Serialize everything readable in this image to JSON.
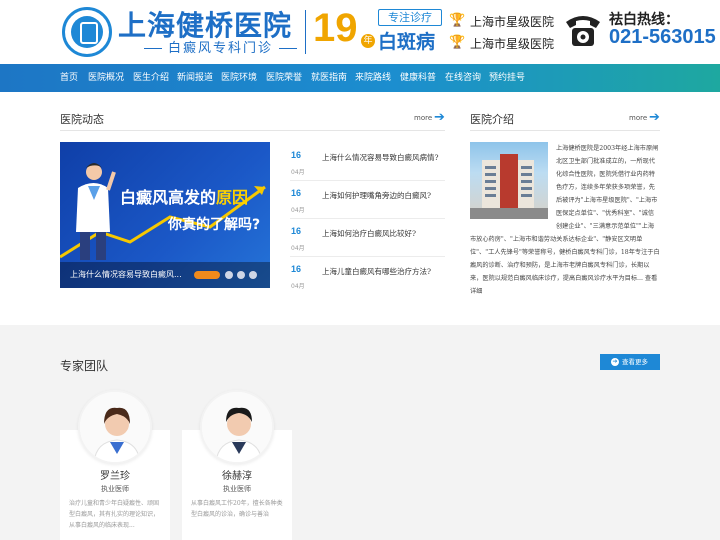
{
  "header": {
    "brand_name": "上海健桥医院",
    "brand_sub": "白癜风专科门诊",
    "years": "19",
    "year_unit": "年",
    "focus_tag": "专注诊疗",
    "focus_big": "白斑病",
    "star_items": [
      "上海市星级医院",
      "上海市星级医院"
    ],
    "hotline_label": "祛白热线：",
    "hotline_number": "021-563015",
    "colors": {
      "primary": "#1e6fc6",
      "accent": "#f0a500"
    }
  },
  "nav": {
    "items": [
      "首页",
      "医院概况",
      "医生介绍",
      "新闻报道",
      "医院环境",
      "医院荣誉",
      "就医指南",
      "来院路线",
      "健康科普",
      "在线咨询",
      "预约挂号"
    ]
  },
  "news": {
    "title": "医院动态",
    "more": "more",
    "banner_line1_a": "白癜风高发的",
    "banner_line1_b": "原因",
    "banner_line2": "你真的了解吗?",
    "caption": "上海什么情况容易导致白癜风...",
    "items": [
      {
        "day": "16",
        "month": "04月",
        "title": "上海什么情况容易导致白癜风病情?"
      },
      {
        "day": "16",
        "month": "04月",
        "title": "上海如何护理嘴角旁边的白癜风?"
      },
      {
        "day": "16",
        "month": "04月",
        "title": "上海如何治疗白癜风比较好?"
      },
      {
        "day": "16",
        "month": "04月",
        "title": "上海儿童白癜风有哪些治疗方法?"
      }
    ]
  },
  "intro": {
    "title": "医院介绍",
    "more": "more",
    "text": "上海健桥医院是2003年经上海市原闸北区卫生部门批准成立的，一所现代化综合性医院，医院凭借行业内药特色疗方，连续多年荣获多项荣誉，先后被评为\"上海市星级医院\"、\"上海市医保定点单位\"、\"优秀科室\"、\"诚信创建企业\"、\"三满意示范单位\"\"上海市放心药房\"、\"上海市和谐劳动关系达标企业\"、\"静安区文明单位\"、\"工人先锋号\"等荣誉称号，健桥白癜风专科门诊，18年专注于白癜风的诊断、治疗和预防，是上海市老牌白癜风专科门诊，长期以来，医院以规范白癜风临床诊疗，提高白癜风诊疗水平为目标... 查看详细"
  },
  "team": {
    "title": "专家团队",
    "view_more": "查看更多",
    "doctors": [
      {
        "name": "罗兰珍",
        "role": "执业医师",
        "desc": "治疗儿童和青少年白疑癜性、顽固型白癜风，其有扎实的理论知识，从事白癜风的临床表现..."
      },
      {
        "name": "徐赫淳",
        "role": "执业医师",
        "desc": "从事白癜风工作20年，擅长各种类型白癜风的诊治，确诊与善治"
      }
    ]
  }
}
